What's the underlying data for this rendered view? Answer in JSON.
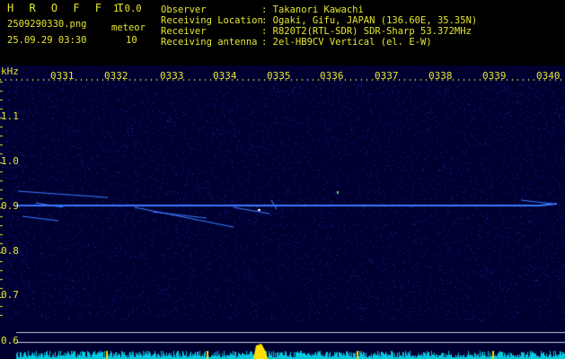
{
  "app": {
    "title_letters": "H R O F F T",
    "version": "1.0.0",
    "file_name": "2509290330.png",
    "datetime": "25.09.29 03:30",
    "meteor_label": "meteor",
    "meteor_count": "10"
  },
  "station": {
    "observer_label": "Observer",
    "observer_value": ": Takanori Kawachi",
    "location_label": "Receiving Location",
    "location_value": ": Ogaki, Gifu, JAPAN (136.60E, 35.35N)",
    "receiver_label": "Receiver",
    "receiver_value": ": R820T2(RTL-SDR) SDR-Sharp 53.372MHz",
    "antenna_label": "Receiving antenna",
    "antenna_value": ": 2el-HB9CV Vertical (el. E-W)"
  },
  "spectrogram": {
    "freq_unit": "kHz",
    "time_labels": [
      "0331",
      "0332",
      "0333",
      "0334",
      "0335",
      "0336",
      "0337",
      "0338",
      "0339",
      "0340"
    ],
    "freq_labels": [
      "1.1",
      "1.0",
      "0.9",
      "0.8",
      "0.7",
      "0.6"
    ],
    "colors": {
      "background": "#000030",
      "carrier": "#3a7aff",
      "grid_line": "#c8c8dc",
      "level_fill": "#00c8e0",
      "burst": "#ffe000"
    }
  }
}
